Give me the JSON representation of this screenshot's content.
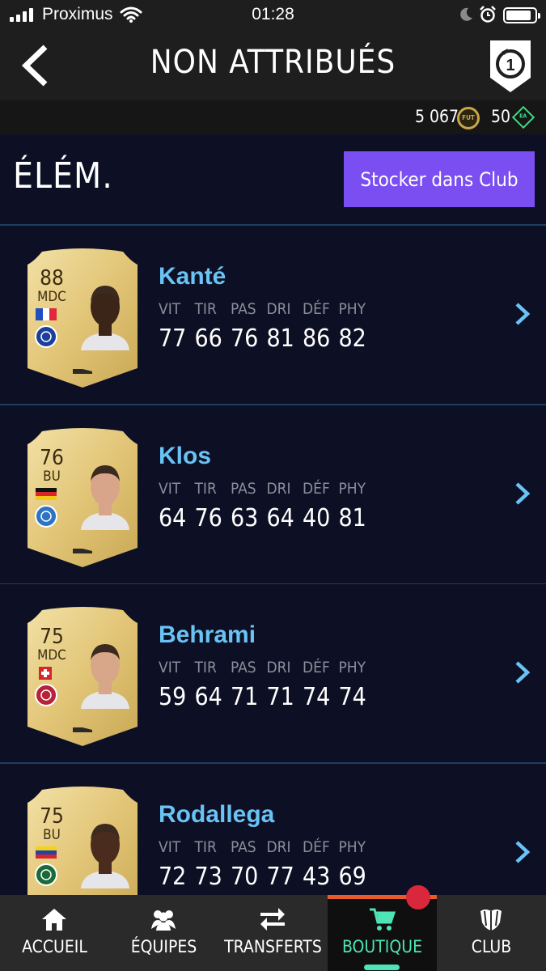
{
  "status_bar": {
    "carrier": "Proximus",
    "time": "01:28",
    "icons": [
      "signal-icon",
      "wifi-icon",
      "moon-icon",
      "alarm-icon",
      "battery-icon"
    ]
  },
  "header": {
    "title": "NON ATTRIBUÉS",
    "back_icon": "back-chevron-icon",
    "pack_badge_count": "1"
  },
  "currency": {
    "coins": "5 067",
    "coin_icon_label": "FUT",
    "points": "50",
    "points_icon_label": "EA"
  },
  "section": {
    "label": "ÉLÉM.",
    "store_button": "Stocker dans Club"
  },
  "stat_labels": [
    "VIT",
    "TIR",
    "PAS",
    "DRI",
    "DÉF",
    "PHY"
  ],
  "players": [
    {
      "name": "Kanté",
      "rating": "88",
      "position": "MDC",
      "flag_colors": [
        "#1f4fbf",
        "#ffffff",
        "#e0283b"
      ],
      "flag_orientation": "vertical",
      "club_color": "#1d3f9c",
      "skin": "#3b2418",
      "stats": [
        "77",
        "66",
        "76",
        "81",
        "86",
        "82"
      ]
    },
    {
      "name": "Klos",
      "rating": "76",
      "position": "BU",
      "flag_colors": [
        "#111111",
        "#d8242b",
        "#f5c518"
      ],
      "flag_orientation": "horizontal",
      "club_color": "#2d74c4",
      "skin": "#d9a58a",
      "stats": [
        "64",
        "76",
        "63",
        "64",
        "40",
        "81"
      ]
    },
    {
      "name": "Behrami",
      "rating": "75",
      "position": "MDC",
      "flag_colors": [
        "#d8242b",
        "#ffffff",
        "#d8242b"
      ],
      "flag_orientation": "swiss",
      "club_color": "#b8213a",
      "skin": "#d8a688",
      "stats": [
        "59",
        "64",
        "71",
        "71",
        "74",
        "74"
      ]
    },
    {
      "name": "Rodallega",
      "rating": "75",
      "position": "BU",
      "flag_colors": [
        "#f5d21a",
        "#1f45a8",
        "#d8242b"
      ],
      "flag_orientation": "horizontal",
      "club_color": "#1b6b3a",
      "skin": "#4a2c1e",
      "stats": [
        "72",
        "73",
        "70",
        "77",
        "43",
        "69"
      ]
    }
  ],
  "nav": {
    "items": [
      {
        "label": "ACCUEIL",
        "icon": "home-icon"
      },
      {
        "label": "ÉQUIPES",
        "icon": "team-icon"
      },
      {
        "label": "TRANSFERTS",
        "icon": "transfer-arrows-icon"
      },
      {
        "label": "BOUTIQUE",
        "icon": "cart-icon"
      },
      {
        "label": "CLUB",
        "icon": "club-shield-icon"
      }
    ],
    "active": "BOUTIQUE"
  },
  "colors": {
    "background": "#0d0f24",
    "accent_purple": "#7a4ef0",
    "name_blue": "#69c3f4",
    "active_green": "#4fe3b5",
    "notification_red": "#d9283b"
  }
}
